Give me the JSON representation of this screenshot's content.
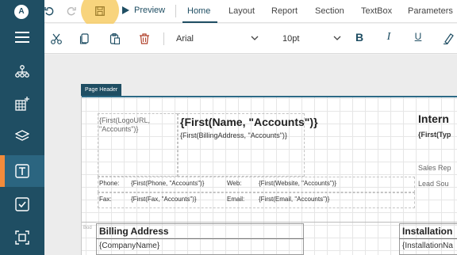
{
  "app": {
    "logo": "A"
  },
  "toolbar": {
    "undo_icon": "undo-icon",
    "redo_icon": "redo-icon",
    "save_icon": "save-icon",
    "preview_label": "Preview",
    "tabs": [
      {
        "label": "Home",
        "active": true
      },
      {
        "label": "Layout"
      },
      {
        "label": "Report"
      },
      {
        "label": "Section"
      },
      {
        "label": "TextBox"
      },
      {
        "label": "Parameters"
      }
    ]
  },
  "format": {
    "font_family": "Arial",
    "font_size": "10pt",
    "bold_label": "B",
    "italic_label": "I",
    "underline_label": "U"
  },
  "sidebar": {
    "items": [
      {
        "icon": "hamburger-menu-icon"
      },
      {
        "icon": "hierarchy-icon"
      },
      {
        "icon": "grid-add-icon"
      },
      {
        "icon": "layers-icon"
      },
      {
        "icon": "textbox-icon",
        "active": true
      },
      {
        "icon": "checkbox-icon"
      },
      {
        "icon": "focus-frame-icon"
      }
    ]
  },
  "report": {
    "page_header_tag": "Page Header",
    "logo_url": "{First(LogoURL, \"Accounts\")}",
    "name_expr": "{First(Name, \"Accounts\")}",
    "billing_address_expr": "{First(BillingAddress, \"Accounts\")}",
    "right_title": "Intern",
    "type_expr": "{First(Typ",
    "sales_rep": "Sales Rep",
    "lead_source": "Lead Sou",
    "phone_label": "Phone:",
    "phone_expr": "{First(Phone, \"Accounts\")}",
    "web_label": "Web:",
    "web_expr": "{First(Website, \"Accounts\")}",
    "fax_label": "Fax:",
    "fax_expr": "{First(Fax, \"Accounts\")}",
    "email_label": "Email:",
    "email_expr": "{First(Email, \"Accounts\")}",
    "band2_tag": "Bod",
    "billing_title": "Billing Address",
    "company_name": "{CompanyName}",
    "installation_title": "Installation",
    "installation_field": "{InstallationNa"
  },
  "colors": {
    "sidebar": "#1f4e63",
    "accent": "#f28b3b",
    "save_highlight": "#f7cc66"
  }
}
